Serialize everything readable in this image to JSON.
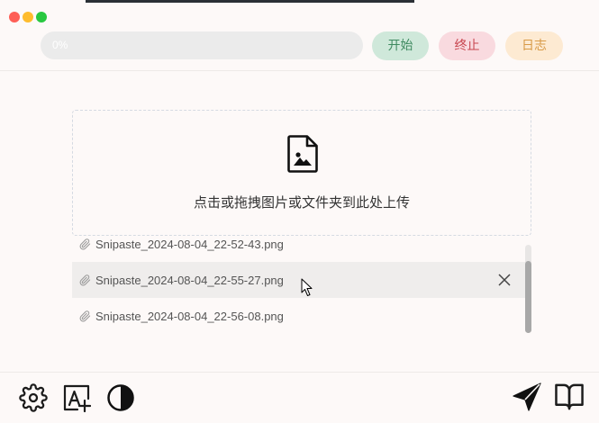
{
  "progress": {
    "value": 0,
    "label": "0%"
  },
  "actions": {
    "start_label": "开始",
    "stop_label": "终止",
    "log_label": "日志"
  },
  "upload": {
    "icon": "file-image-icon",
    "hint": "点击或拖拽图片或文件夹到此处上传"
  },
  "file_list": {
    "scroll_fraction": 1,
    "items": [
      {
        "name": "Snipaste_2024-08-04_22-52-43.png",
        "icon": "paperclip-icon",
        "hovered": false
      },
      {
        "name": "Snipaste_2024-08-04_22-55-27.png",
        "icon": "paperclip-icon",
        "hovered": true,
        "action_icon": "close-icon"
      },
      {
        "name": "Snipaste_2024-08-04_22-56-08.png",
        "icon": "paperclip-icon",
        "hovered": false
      }
    ]
  },
  "toolbar": {
    "left": [
      "gear-icon",
      "text-add-icon",
      "contrast-icon"
    ],
    "right": [
      "send-icon",
      "book-open-icon"
    ]
  },
  "colors": {
    "background": "#fdf9f8",
    "window_close": "#fe5f57",
    "window_minimize": "#febc2e",
    "window_maximize": "#28c840",
    "progress_track": "#ebebeb",
    "progress_text": "#ffffff",
    "start_bg": "#cfe8da",
    "start_text": "#3f8a60",
    "stop_bg": "#f9dadf",
    "stop_text": "#c8464f",
    "log_bg": "#fdead2",
    "log_text": "#d89a47",
    "divider": "#eeeae8",
    "dropzone_border": "#d5dae2",
    "row_hover": "#efedec",
    "text": "#333333"
  }
}
